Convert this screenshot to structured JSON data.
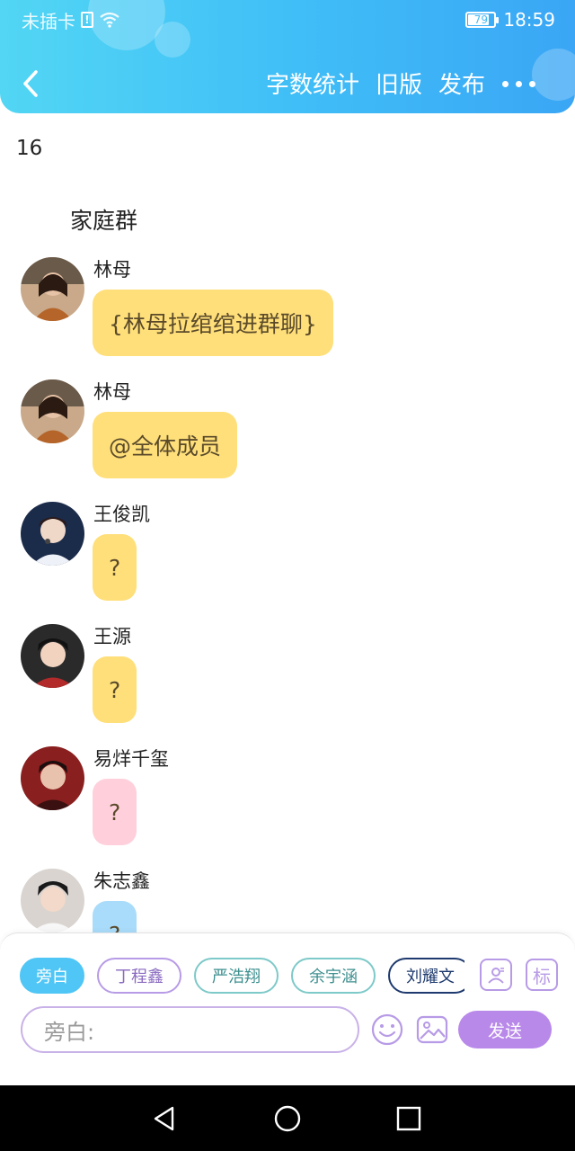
{
  "status_bar": {
    "carrier": "未插卡",
    "sim_mark": "!",
    "battery": "79",
    "time": "18:59"
  },
  "header": {
    "actions": [
      "字数统计",
      "旧版",
      "发布"
    ]
  },
  "word_count": "16",
  "group_title": "家庭群",
  "messages": [
    {
      "sender": "林母",
      "text": "{林母拉绾绾进群聊}",
      "bubble_color": "#ffdf7a",
      "avatar_color": "#7a4a30"
    },
    {
      "sender": "林母",
      "text": "@全体成员",
      "bubble_color": "#ffdf7a",
      "avatar_color": "#7a4a30"
    },
    {
      "sender": "王俊凯",
      "text": "?",
      "bubble_color": "#ffdf7a",
      "avatar_color": "#1b2b4a"
    },
    {
      "sender": "王源",
      "text": "?",
      "bubble_color": "#ffdf7a",
      "avatar_color": "#5a2a2a"
    },
    {
      "sender": "易烊千玺",
      "text": "?",
      "bubble_color": "#ffd0dc",
      "avatar_color": "#6b1f1f"
    },
    {
      "sender": "朱志鑫",
      "text": "?",
      "bubble_color": "#a9dcfa",
      "avatar_color": "#e8e0dc"
    }
  ],
  "roles": [
    {
      "label": "旁白",
      "active": true,
      "color": "#4fc6f5"
    },
    {
      "label": "丁程鑫",
      "active": false,
      "color": "#b79be6"
    },
    {
      "label": "严浩翔",
      "active": false,
      "color": "#7ec9c9"
    },
    {
      "label": "余宇涵",
      "active": false,
      "color": "#7ec9c9"
    },
    {
      "label": "刘耀文",
      "active": false,
      "color": "#1e3a6e"
    }
  ],
  "tools": {
    "role_icon": "person-card-icon",
    "tag_label": "标"
  },
  "input": {
    "placeholder": "旁白:"
  },
  "send_label": "发送",
  "colors": {
    "header_start": "#52d6f4",
    "header_end": "#3aa6f5",
    "send": "#b989ea",
    "input_border": "#c9b2e8"
  }
}
